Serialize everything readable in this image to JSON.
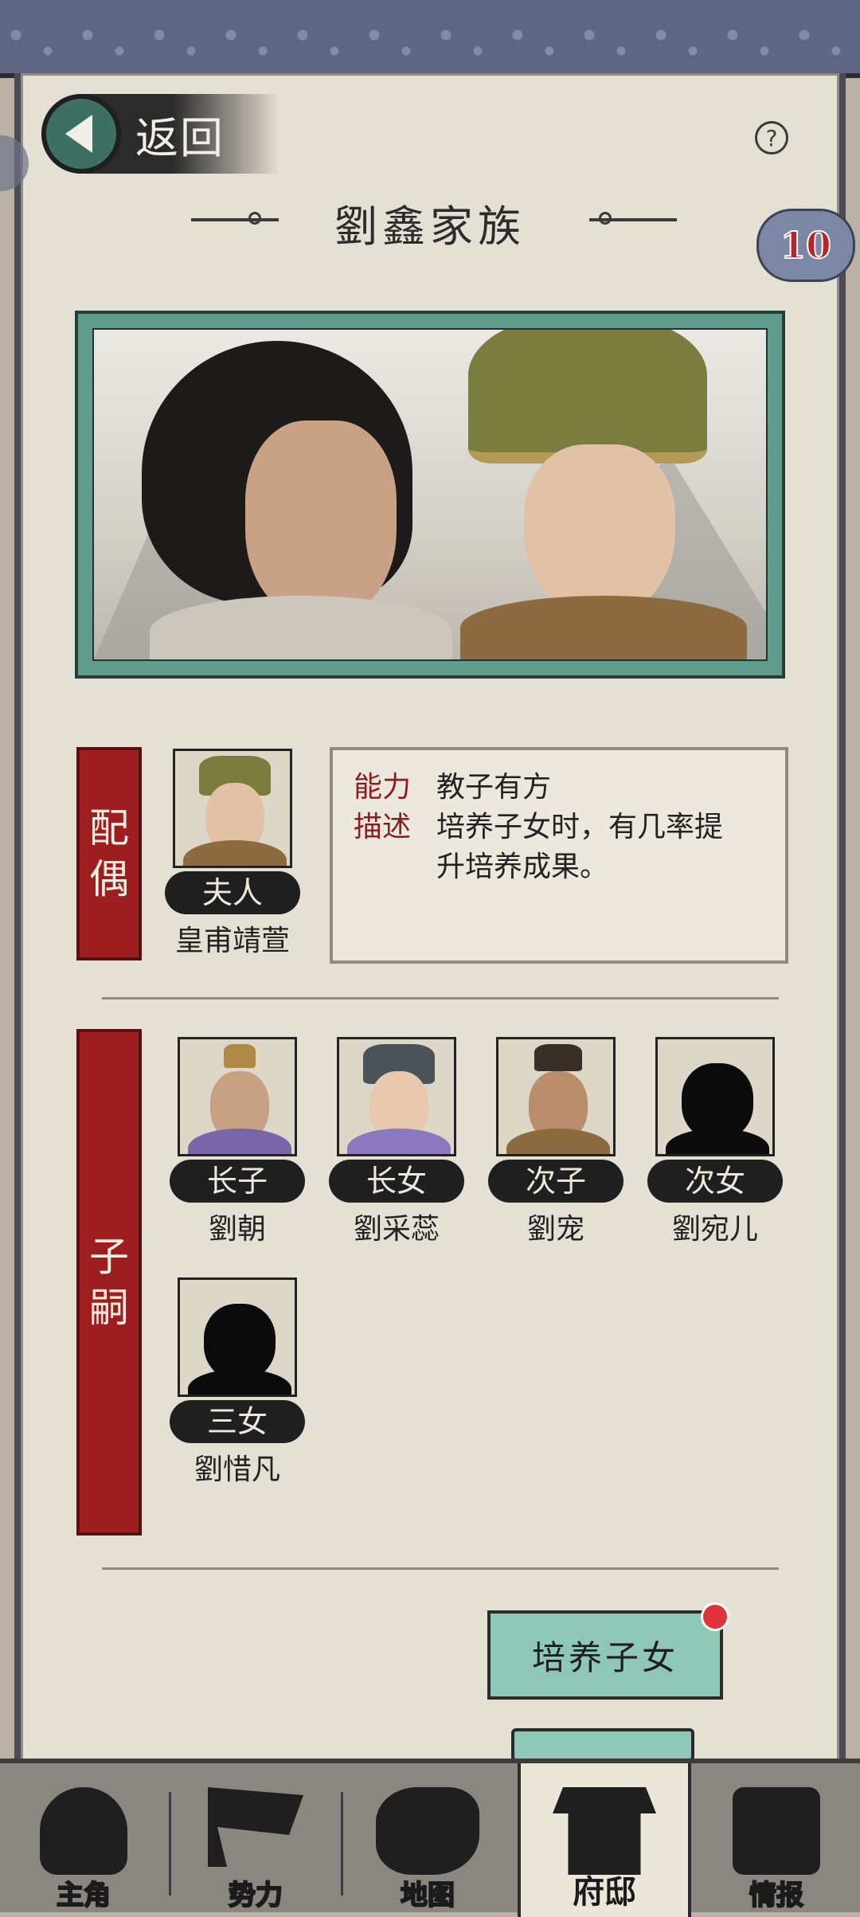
{
  "header": {
    "back_label": "返回",
    "help_symbol": "?",
    "title": "劉鑫家族",
    "badge_count": "10"
  },
  "spouse": {
    "section_label": [
      "配",
      "偶"
    ],
    "role": "夫人",
    "name": "皇甫靖萱",
    "ability_key": "能力",
    "ability_value": "教子有方",
    "desc_key": "描述",
    "desc_value_line1": "培养子女时，有几率提",
    "desc_value_line2": "升培养成果。"
  },
  "children": {
    "section_label": [
      "子",
      "嗣"
    ],
    "items": [
      {
        "role": "长子",
        "name": "劉朝"
      },
      {
        "role": "长女",
        "name": "劉采蕊"
      },
      {
        "role": "次子",
        "name": "劉宠"
      },
      {
        "role": "次女",
        "name": "劉宛儿"
      },
      {
        "role": "三女",
        "name": "劉惜凡"
      }
    ]
  },
  "action_button": {
    "label": "培养子女"
  },
  "bottom_nav": {
    "items": [
      {
        "label": "主角"
      },
      {
        "label": "势力"
      },
      {
        "label": "地图"
      },
      {
        "label": "府邸"
      },
      {
        "label": "情报"
      }
    ]
  },
  "colors": {
    "accent_teal": "#8fc7b6",
    "banner_red": "#9e1e20",
    "badge_red": "#e0343a"
  }
}
